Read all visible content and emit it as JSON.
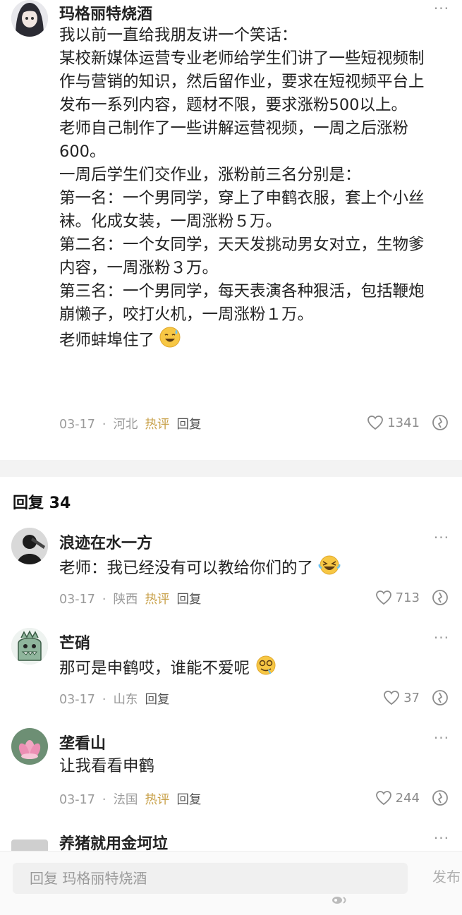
{
  "main_comment": {
    "username": "玛格丽特烧酒",
    "lines": [
      "我以前一直给我朋友讲一个笑话：",
      "某校新媒体运营专业老师给学生们讲了一些短视频制",
      "作与营销的知识，然后留作业，要求在短视频平台上",
      "发布一系列内容，题材不限，要求涨粉500以上。",
      "老师自己制作了一些讲解运营视频，一周之后涨粉",
      "600。",
      "一周后学生们交作业，涨粉前三名分别是：",
      "第一名：一个男同学，穿上了申鹤衣服，套上个小丝",
      "袜。化成女装，一周涨粉５万。",
      "第二名：一个女同学，天天发挑动男女对立，生物爹",
      "内容，一周涨粉３万。",
      "第三名：一个男同学，每天表演各种狠活，包括鞭炮",
      "崩懒子，咬打火机，一周涨粉１万。",
      "老师蚌埠住了"
    ],
    "last_line_emoji": "sweat-smile-emoji",
    "date": "03-17",
    "location": "河北",
    "hot_tag": "热评",
    "reply_label": "回复",
    "likes": "1341"
  },
  "replies_header": "回复 34",
  "replies": [
    {
      "username": "浪迹在水一方",
      "text": "老师：我已经没有可以教给你们的了",
      "emoji": "rolling-laugh-emoji",
      "date": "03-17",
      "location": "陕西",
      "hot_tag": "热评",
      "reply_label": "回复",
      "likes": "713"
    },
    {
      "username": "芒硝",
      "text": "那可是申鹤哎，谁能不爱呢",
      "emoji": "drooling-emoji",
      "date": "03-17",
      "location": "山东",
      "hot_tag": "",
      "reply_label": "回复",
      "likes": "37"
    },
    {
      "username": "垄看山",
      "text": "让我看看申鹤",
      "emoji": "",
      "date": "03-17",
      "location": "法国",
      "hot_tag": "热评",
      "reply_label": "回复",
      "likes": "244"
    },
    {
      "username": "养猪就用金坷垃"
    }
  ],
  "bottom_bar": {
    "placeholder": "回复 玛格丽特烧酒",
    "send_label": "发布"
  },
  "separator_dot": "·",
  "more_glyph": "···",
  "colors": {
    "hot_tag": "#c9a24b",
    "meta_text": "#9a9a9a",
    "divider_band": "#f3f3f3"
  }
}
